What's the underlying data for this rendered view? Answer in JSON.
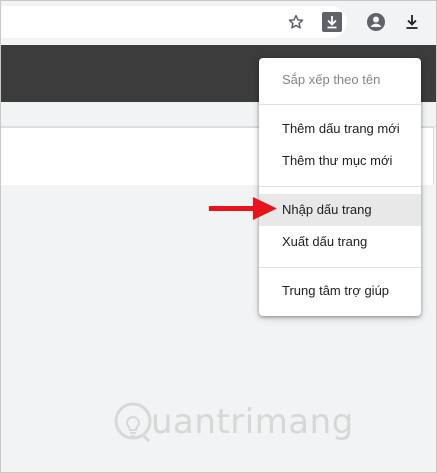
{
  "toolbar": {
    "icons": [
      "star-icon",
      "download-box-icon",
      "account-icon",
      "download-icon"
    ]
  },
  "menu": {
    "items": [
      {
        "label": "Sắp xếp theo tên",
        "enabled": false
      },
      {
        "label": "Thêm dấu trang mới",
        "enabled": true
      },
      {
        "label": "Thêm thư mục mới",
        "enabled": true
      },
      {
        "label": "Nhập dấu trang",
        "enabled": true,
        "highlighted": true
      },
      {
        "label": "Xuất dấu trang",
        "enabled": true
      },
      {
        "label": "Trung tâm trợ giúp",
        "enabled": true
      }
    ]
  },
  "annotation": {
    "arrow_color": "#e8141c"
  },
  "watermark": {
    "text": "uantrimang"
  },
  "colors": {
    "dark_header": "#3c3c3c",
    "menu_highlight": "#e8e8e8",
    "arrow": "#e8141c"
  }
}
